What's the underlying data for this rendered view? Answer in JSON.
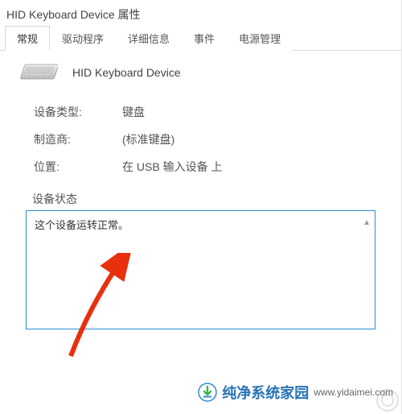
{
  "window": {
    "title": "HID Keyboard Device 属性"
  },
  "tabs": {
    "items": [
      {
        "label": "常规"
      },
      {
        "label": "驱动程序"
      },
      {
        "label": "详细信息"
      },
      {
        "label": "事件"
      },
      {
        "label": "电源管理"
      }
    ],
    "active_index": 0
  },
  "device": {
    "icon": "keyboard-icon",
    "name": "HID Keyboard Device"
  },
  "fields": {
    "type_label": "设备类型:",
    "type_value": "键盘",
    "mfr_label": "制造商:",
    "mfr_value": "(标准键盘)",
    "loc_label": "位置:",
    "loc_value": "在 USB 输入设备 上"
  },
  "status": {
    "label": "设备状态",
    "text": "这个设备运转正常。"
  },
  "watermark": {
    "brand": "纯净系统家园",
    "url": "www.yidaimei.com"
  },
  "colors": {
    "accent": "#2a8dd4",
    "arrow": "#e8300f"
  }
}
